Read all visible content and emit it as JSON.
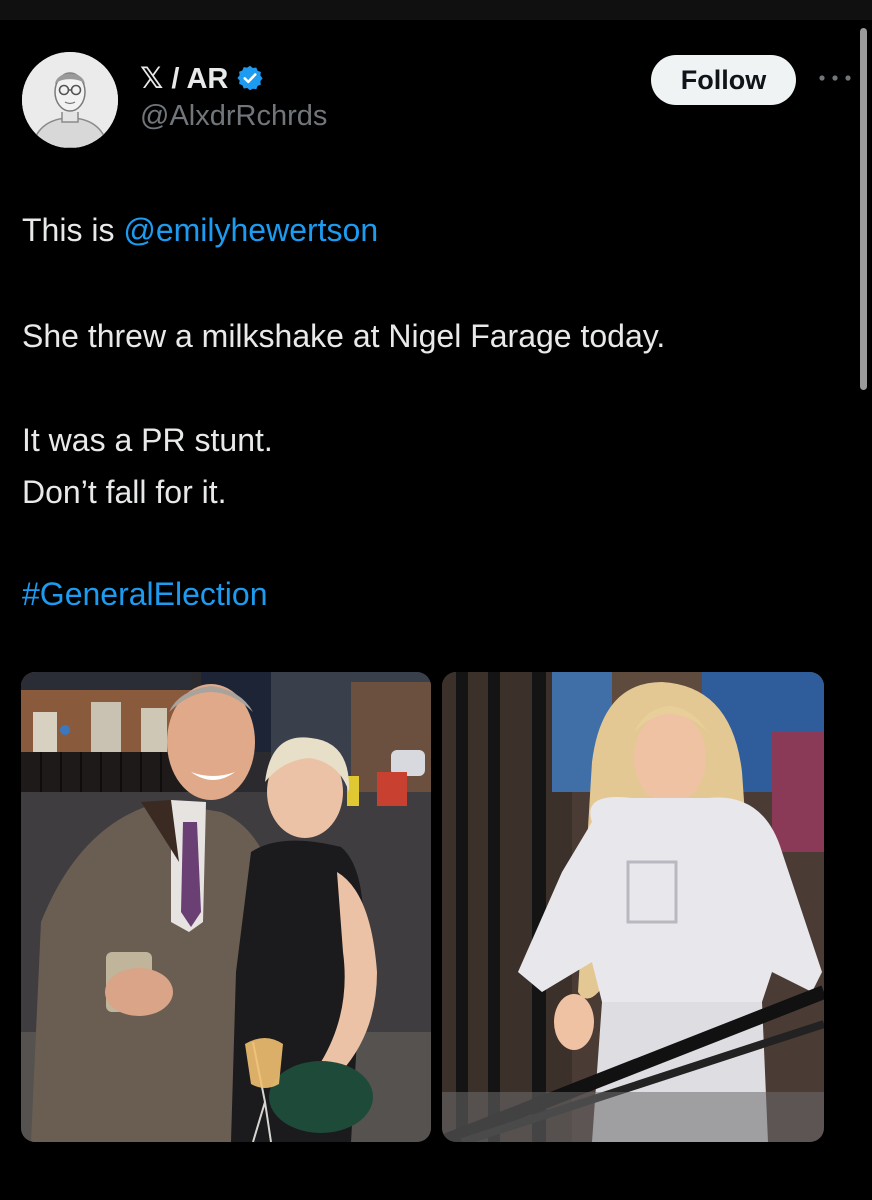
{
  "tweet": {
    "author": {
      "display_name": "𝕏 / AR",
      "handle": "@AlxdrRchrds",
      "verified": true,
      "avatar_icon": "person-sketch-avatar"
    },
    "follow_label": "Follow",
    "more_icon": "more-horizontal-icon",
    "text": {
      "line1_prefix": "This is ",
      "mention": "@emilyhewertson",
      "line2": "She threw a milkshake at Nigel Farage today.",
      "line3": "It was a PR stunt.",
      "line4": "Don’t fall for it.",
      "hashtag": "#GeneralElection"
    },
    "media": [
      {
        "icon": "photo-man-and-woman-street-night"
      },
      {
        "icon": "photo-woman-white-hoodie"
      }
    ]
  },
  "colors": {
    "background": "#000000",
    "text": "#e7e9ea",
    "secondary_text": "#71767b",
    "link": "#1d9bf0",
    "follow_bg": "#eff3f4",
    "follow_text": "#0f1419"
  }
}
